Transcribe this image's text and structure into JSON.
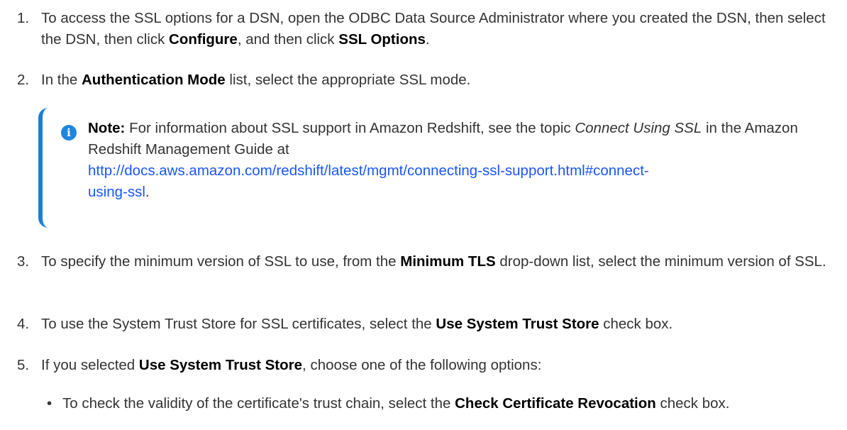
{
  "steps": [
    {
      "num": "1.",
      "parts": [
        "To access the SSL options for a DSN, open the ODBC Data Source Administrator where you created the DSN, then select the DSN, then click ",
        "Configure",
        ", and then click ",
        "SSL Options",
        "."
      ]
    },
    {
      "num": "2.",
      "parts": [
        "In the ",
        "Authentication Mode",
        " list, select the appropriate SSL mode."
      ]
    },
    {
      "num": "3.",
      "parts": [
        "To specify the minimum version of SSL to use, from the ",
        "Minimum TLS",
        " drop-down list, select the minimum version of SSL."
      ]
    },
    {
      "num": "4.",
      "parts": [
        "To use the System Trust Store for SSL certificates, select the ",
        "Use System Trust Store",
        " check box."
      ]
    },
    {
      "num": "5.",
      "parts": [
        "If you selected ",
        "Use System Trust Store",
        ", choose one of the following options:"
      ]
    }
  ],
  "note": {
    "icon": "info-icon",
    "label": "Note:",
    "text1": " For information about SSL support in Amazon Redshift, see the topic ",
    "topic": "Connect Using SSL",
    "text2": " in the Amazon Redshift Management Guide at ",
    "link_line1": "http://docs.aws.amazon.com/redshift/latest/mgmt/connecting-ssl-support.html#connect-",
    "link_line2": "using-ssl",
    "text3": "."
  },
  "bullets": [
    {
      "dot": "•",
      "parts": [
        "To check the validity of the certificate's trust chain, select the ",
        "Check Certificate Revocation",
        " check box."
      ]
    }
  ]
}
